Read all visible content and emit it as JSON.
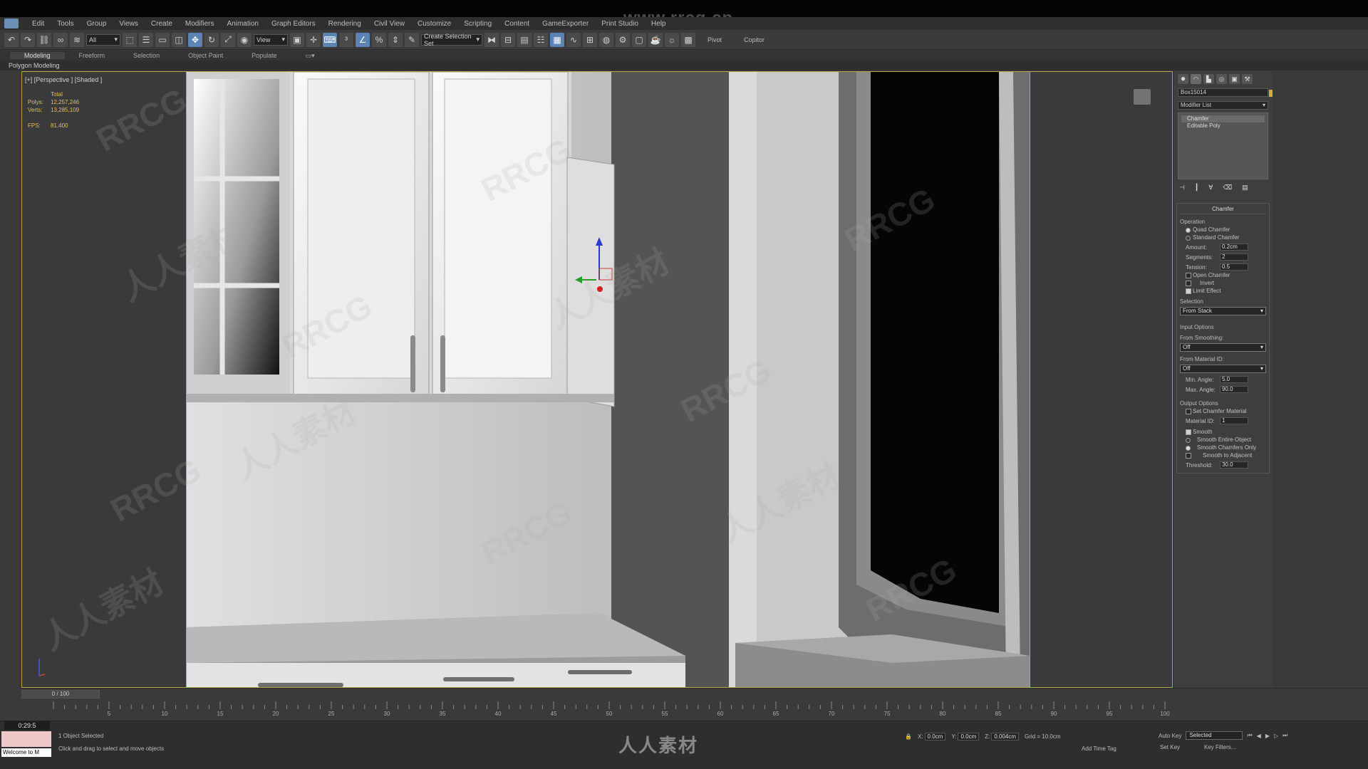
{
  "menu": {
    "items": [
      "Edit",
      "Tools",
      "Group",
      "Views",
      "Create",
      "Modifiers",
      "Animation",
      "Graph Editors",
      "Rendering",
      "Civil View",
      "Customize",
      "Scripting",
      "Content",
      "GameExporter",
      "Print Studio",
      "Help"
    ]
  },
  "watermark": {
    "url": "www.rrcg.cn",
    "text_a": "RRCG",
    "text_b": "人人素材",
    "bottom_logo": "人人素材"
  },
  "toolbar": {
    "selection_filter": "All",
    "ref_coord": "View",
    "named_selection": "Create Selection Set",
    "pivot": "Pivot",
    "copitor": "Copitor"
  },
  "ribbon": {
    "tabs": [
      "Modeling",
      "Freeform",
      "Selection",
      "Object Paint",
      "Populate"
    ],
    "sub_label": "Polygon Modeling"
  },
  "viewport": {
    "label": "[+] [Perspective ] [Shaded ]",
    "stats": {
      "total_label": "Total",
      "polys_label": "Polys:",
      "polys_value": "12,257,246",
      "verts_label": "Verts:",
      "verts_value": "13,285,109",
      "fps_label": "FPS:",
      "fps_value": "81.400"
    }
  },
  "command_panel": {
    "object_name": "Box15014",
    "modifier_list": "Modifier List",
    "stack": [
      "Chamfer",
      "Editable Poly"
    ],
    "rollout_title": "Chamfer",
    "operation_label": "Operation",
    "quad_chamfer": "Quad Chamfer",
    "standard_chamfer": "Standard Chamfer",
    "amount_label": "Amount:",
    "amount_value": "0.2cm",
    "segments_label": "Segments:",
    "segments_value": "2",
    "tension_label": "Tension:",
    "tension_value": "0.5",
    "open_chamfer": "Open Chamfer",
    "invert": "Invert",
    "limit_effect": "Limit Effect",
    "selection_label": "Selection",
    "selection_value": "From Stack",
    "input_options": "Input Options",
    "from_smoothing": "From Smoothing:",
    "from_smoothing_value": "Off",
    "from_material": "From Material ID:",
    "from_material_value": "Off",
    "min_angle_label": "Min. Angle:",
    "min_angle_value": "5.0",
    "max_angle_label": "Max. Angle:",
    "max_angle_value": "90.0",
    "output_options": "Output Options",
    "set_chamfer_material": "Set Chamfer Material",
    "material_id_label": "Material ID:",
    "material_id_value": "1",
    "smooth": "Smooth",
    "smooth_entire": "Smooth Entire Object",
    "smooth_chamfers": "Smooth Chamfers Only",
    "smooth_adjacent": "Smooth to Adjacent",
    "threshold_label": "Threshold:",
    "threshold_value": "30.0"
  },
  "timeline": {
    "slider": "0 / 100",
    "ticks": [
      "5",
      "10",
      "15",
      "20",
      "25",
      "30",
      "35",
      "40",
      "45",
      "50",
      "55",
      "60",
      "65",
      "70",
      "75",
      "80",
      "85",
      "90",
      "95",
      "100"
    ]
  },
  "status": {
    "time": "0:29:5",
    "maxscript": "Welcome to M",
    "selected": "1 Object Selected",
    "prompt": "Click and drag to select and move objects",
    "x_label": "X:",
    "x_value": "0.0cm",
    "y_label": "Y:",
    "y_value": "0.0cm",
    "z_label": "Z:",
    "z_value": "0.004cm",
    "grid": "Grid = 10.0cm",
    "add_time_tag": "Add Time Tag",
    "auto_key": "Auto Key",
    "set_key": "Set Key",
    "selected_dropdown": "Selected",
    "key_filters": "Key Filters..."
  }
}
